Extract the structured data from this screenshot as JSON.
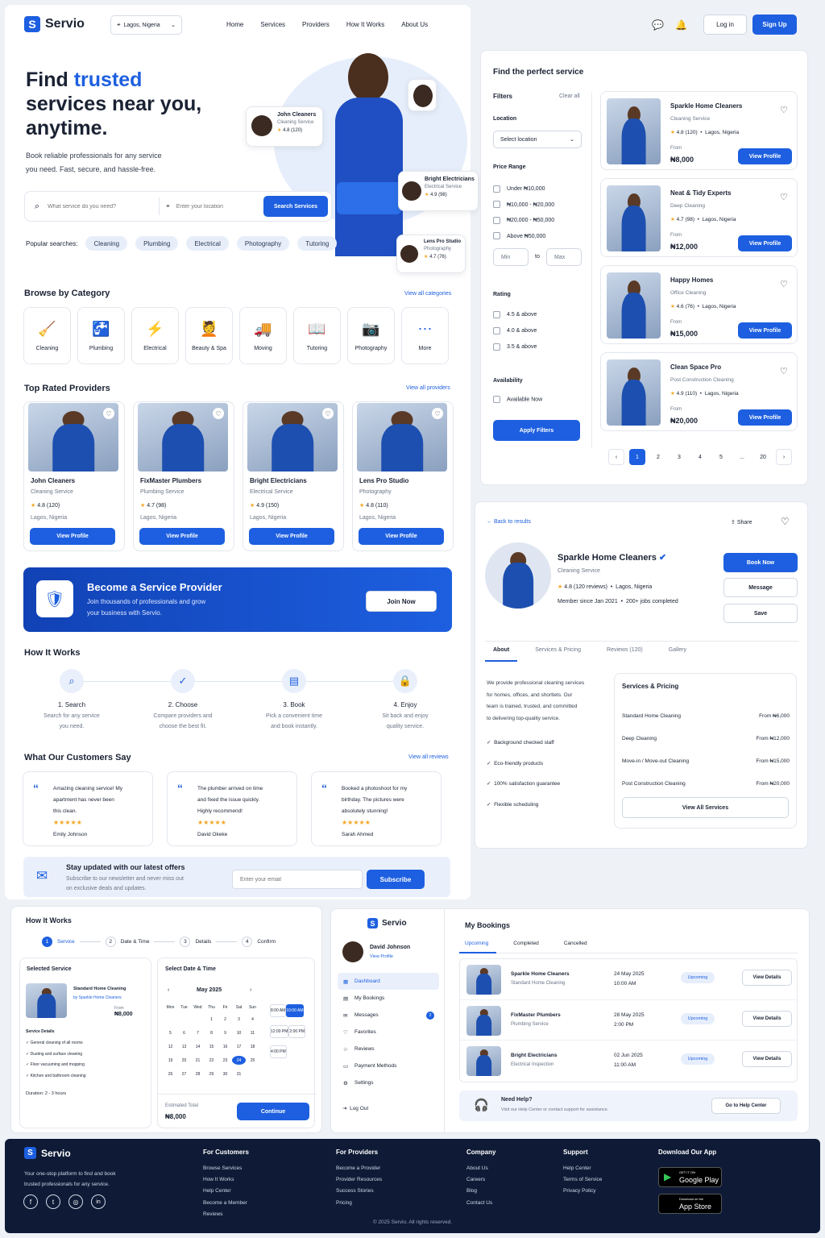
{
  "brand": "Servio",
  "header": {
    "location": "Lagos, Nigeria",
    "nav": [
      "Home",
      "Services",
      "Providers",
      "How It Works",
      "About Us"
    ],
    "login": "Log in",
    "signup": "Sign Up"
  },
  "hero": {
    "title_1": "Find ",
    "title_accent": "trusted",
    "title_2": "services near you,",
    "title_3": "anytime.",
    "subtitle_1": "Book reliable professionals for any service",
    "subtitle_2": "you need. Fast, secure, and hassle-free.",
    "search_placeholder": "What service do you need?",
    "location_placeholder": "Enter your location",
    "search_button": "Search Services",
    "popular_label": "Popular searches:",
    "popular": [
      "Cleaning",
      "Plumbing",
      "Electrical",
      "Photography",
      "Tutoring"
    ],
    "badges": [
      {
        "name": "John Cleaners",
        "service": "Cleaning Service",
        "rating": "4.8 (120)"
      },
      {
        "name": "Bright Electricians",
        "service": "Electrical Service",
        "rating": "4.9 (98)"
      },
      {
        "name": "Lens Pro Studio",
        "service": "Photography",
        "rating": "4.7 (76)"
      }
    ]
  },
  "categories": {
    "title": "Browse by Category",
    "view_all": "View all categories",
    "items": [
      "Cleaning",
      "Plumbing",
      "Electrical",
      "Beauty & Spa",
      "Moving",
      "Tutoring",
      "Photography",
      "More"
    ]
  },
  "top": {
    "title": "Top Rated Providers",
    "view_all": "View all providers",
    "items": [
      {
        "name": "John Cleaners",
        "service": "Cleaning Service",
        "rating": "4.8 (120)",
        "loc": "Lagos, Nigeria",
        "btn": "View Profile"
      },
      {
        "name": "FixMaster Plumbers",
        "service": "Plumbing Service",
        "rating": "4.7 (98)",
        "loc": "Lagos, Nigeria",
        "btn": "View Profile"
      },
      {
        "name": "Bright Electricians",
        "service": "Electrical Service",
        "rating": "4.9 (150)",
        "loc": "Lagos, Nigeria",
        "btn": "View Profile"
      },
      {
        "name": "Lens Pro Studio",
        "service": "Photography",
        "rating": "4.8 (110)",
        "loc": "Lagos, Nigeria",
        "btn": "View Profile"
      }
    ]
  },
  "become": {
    "title": "Become a Service Provider",
    "line1": "Join thousands of professionals and grow",
    "line2": "your business with Servio.",
    "btn": "Join Now"
  },
  "how": {
    "title": "How It Works",
    "steps": [
      {
        "t": "1. Search",
        "d1": "Search for any service",
        "d2": "you need."
      },
      {
        "t": "2. Choose",
        "d1": "Compare providers and",
        "d2": "choose the best fit."
      },
      {
        "t": "3. Book",
        "d1": "Pick a convenient time",
        "d2": "and book instantly."
      },
      {
        "t": "4. Enjoy",
        "d1": "Sit back and enjoy",
        "d2": "quality service."
      }
    ]
  },
  "reviews": {
    "title": "What Our Customers Say",
    "view_all": "View all reviews",
    "items": [
      {
        "l1": "Amazing cleaning service! My",
        "l2": "apartment has never been",
        "l3": "this clean.",
        "stars": "★★★★★",
        "who": "Emily Johnson"
      },
      {
        "l1": "The plumber arrived on time",
        "l2": "and fixed the issue quickly.",
        "l3": "Highly recommend!",
        "stars": "★★★★★",
        "who": "David Okeke"
      },
      {
        "l1": "Booked a photoshoot for my",
        "l2": "birthday. The pictures were",
        "l3": "absolutely stunning!",
        "stars": "★★★★★",
        "who": "Sarah Ahmed"
      }
    ]
  },
  "newsletter": {
    "title": "Stay updated with our latest offers",
    "l1": "Subscribe to our newsletter and never miss out",
    "l2": "on exclusive deals and updates.",
    "placeholder": "Enter your email",
    "btn": "Subscribe"
  },
  "finder": {
    "title": "Find the perfect service",
    "filters": "Filters",
    "clear": "Clear all",
    "location_label": "Location",
    "location_select": "Select location",
    "price_label": "Price Range",
    "prices": [
      "Under ₦10,000",
      "₦10,000 - ₦20,000",
      "₦20,000 - ₦50,000",
      "Above ₦50,000"
    ],
    "min": "Min",
    "to": "to",
    "max": "Max",
    "rating_label": "Rating",
    "ratings": [
      "4.5 & above",
      "4.0 & above",
      "3.5 & above"
    ],
    "avail_label": "Availability",
    "avail": "Available Now",
    "apply": "Apply Filters",
    "results": [
      {
        "name": "Sparkle Home Cleaners",
        "service": "Cleaning Service",
        "rating": "4.8 (120)",
        "loc": "Lagos, Nigeria",
        "from": "From",
        "price": "₦8,000",
        "btn": "View Profile"
      },
      {
        "name": "Neat & Tidy Experts",
        "service": "Deep Cleaning",
        "rating": "4.7 (98)",
        "loc": "Lagos, Nigeria",
        "from": "From",
        "price": "₦12,000",
        "btn": "View Profile"
      },
      {
        "name": "Happy Homes",
        "service": "Office Cleaning",
        "rating": "4.6 (76)",
        "loc": "Lagos, Nigeria",
        "from": "From",
        "price": "₦15,000",
        "btn": "View Profile"
      },
      {
        "name": "Clean Space Pro",
        "service": "Post Construction Cleaning",
        "rating": "4.9 (110)",
        "loc": "Lagos, Nigeria",
        "from": "From",
        "price": "₦20,000",
        "btn": "View Profile"
      }
    ],
    "pages": [
      "‹",
      "1",
      "2",
      "3",
      "4",
      "5",
      "...",
      "20",
      "›"
    ]
  },
  "profile": {
    "back": "Back to results",
    "share": "Share",
    "name": "Sparkle Home Cleaners",
    "service": "Cleaning Service",
    "rating": "4.8 (120 reviews)",
    "loc": "Lagos, Nigeria",
    "member": "Member since Jan 2021",
    "jobs": "200+ jobs completed",
    "book": "Book Now",
    "message": "Message",
    "save": "Save",
    "tabs": [
      "About",
      "Services & Pricing",
      "Reviews (120)",
      "Gallery"
    ],
    "about": [
      "We provide professional cleaning services",
      "for homes, offices, and shortlets. Our",
      "team is trained, trusted, and committed",
      "to delivering top-quality service."
    ],
    "features": [
      "Background checked staff",
      "Eco-friendly products",
      "100% satisfaction guarantee",
      "Flexible scheduling"
    ],
    "pricing_title": "Services & Pricing",
    "pricing": [
      {
        "s": "Standard Home Cleaning",
        "p": "From ₦6,000"
      },
      {
        "s": "Deep Cleaning",
        "p": "From ₦12,000"
      },
      {
        "s": "Move-in / Move-out Cleaning",
        "p": "From ₦15,000"
      },
      {
        "s": "Post Construction Cleaning",
        "p": "From ₦20,000"
      }
    ],
    "view_all": "View All Services"
  },
  "booking": {
    "title": "How It Works",
    "steps": [
      "Service",
      "Date & Time",
      "Details",
      "Confirm"
    ],
    "sel_title": "Selected Service",
    "svc": "Standard Home Cleaning",
    "by": "by Sparkle Home Cleaners",
    "from": "From",
    "price": "₦8,000",
    "details_title": "Service Details",
    "details": [
      "General cleaning of all rooms",
      "Dusting and surface cleaning",
      "Floor vacuuming and mopping",
      "Kitchen and bathroom cleaning"
    ],
    "duration": "Duration: 2 - 3 hours",
    "date_title": "Select Date & Time",
    "month": "May 2025",
    "days": [
      "Mon",
      "Tue",
      "Wed",
      "Thu",
      "Fri",
      "Sat",
      "Sun"
    ],
    "dates": [
      "",
      "",
      "",
      "1",
      "2",
      "3",
      "4",
      "5",
      "6",
      "7",
      "8",
      "9",
      "10",
      "11",
      "12",
      "13",
      "14",
      "15",
      "16",
      "17",
      "18",
      "19",
      "20",
      "21",
      "22",
      "23",
      "24",
      "25",
      "26",
      "27",
      "28",
      "29",
      "30",
      "31",
      ""
    ],
    "selected_date": "24",
    "times": [
      "8:00 AM",
      "10:00 AM",
      "12:00 PM",
      "2:00 PM",
      "4:00 PM"
    ],
    "selected_time": "10:00 AM",
    "est": "Estimated Total",
    "total": "₦8,000",
    "continue": "Continue"
  },
  "dash": {
    "user": "David Johnson",
    "view": "View Profile",
    "menu": [
      "Dashboard",
      "My Bookings",
      "Messages",
      "Favorites",
      "Reviews",
      "Payment Methods",
      "Settings"
    ],
    "msg_count": "2",
    "logout": "Log Out",
    "title": "My Bookings",
    "tabs": [
      "Upcoming",
      "Completed",
      "Cancelled"
    ],
    "rows": [
      {
        "n": "Sparkle Home Cleaners",
        "s": "Standard Home Cleaning",
        "d": "24 May 2025",
        "t": "10:00 AM",
        "st": "Upcoming",
        "b": "View Details"
      },
      {
        "n": "FixMaster Plumbers",
        "s": "Plumbing Service",
        "d": "28 May 2025",
        "t": "2:00 PM",
        "st": "Upcoming",
        "b": "View Details"
      },
      {
        "n": "Bright Electricians",
        "s": "Electrical Inspection",
        "d": "02 Jun 2025",
        "t": "11:00 AM",
        "st": "Upcoming",
        "b": "View Details"
      }
    ],
    "help": "Need Help?",
    "help_sub": "Visit our Help Center or contact support for assistance.",
    "help_btn": "Go to Help Center"
  },
  "footer": {
    "tag1": "Your one-stop platform to find and book",
    "tag2": "trusted professionals for any service.",
    "cols": [
      {
        "h": "For Customers",
        "l": [
          "Browse Services",
          "How It Works",
          "Help Center",
          "Become a Member",
          "Reviews"
        ]
      },
      {
        "h": "For Providers",
        "l": [
          "Become a Provider",
          "Provider Resources",
          "Success Stories",
          "Pricing"
        ]
      },
      {
        "h": "Company",
        "l": [
          "About Us",
          "Careers",
          "Blog",
          "Contact Us"
        ]
      },
      {
        "h": "Support",
        "l": [
          "Help Center",
          "Terms of Service",
          "Privacy Policy"
        ]
      }
    ],
    "app": "Download Our App",
    "gp_small": "GET IT ON",
    "gp": "Google Play",
    "as_small": "Download on the",
    "as": "App Store",
    "copy": "© 2025 Servio. All rights reserved."
  }
}
